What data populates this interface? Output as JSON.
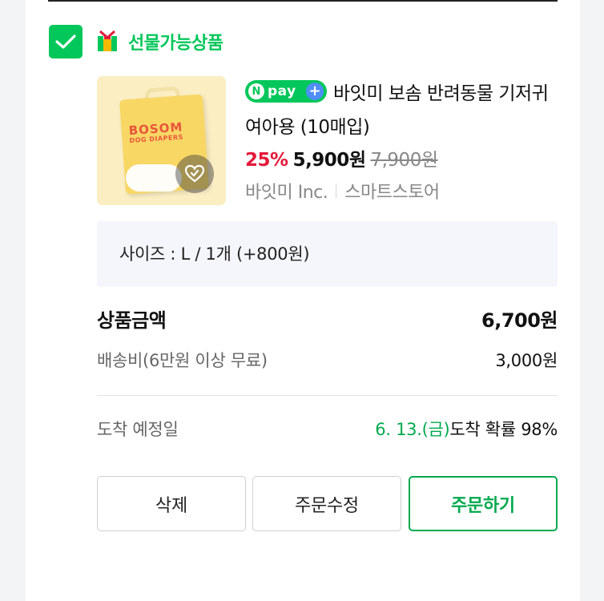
{
  "group": {
    "checked": true,
    "title": "선물가능상품",
    "icon": "gift-icon"
  },
  "product": {
    "thumbnail_text": "BOSOM",
    "thumbnail_subtext": "DOG DIAPERS",
    "wish_icon": "heart-check-icon",
    "badge": {
      "n": "N",
      "text": "pay",
      "plus": "+"
    },
    "name": "바잇미 보솜 반려동물 기저귀 여아용 (10매입)",
    "discount": "25%",
    "price": "5,900원",
    "original_price": "7,900원",
    "seller": "바잇미 Inc.",
    "store_type": "스마트스토어"
  },
  "option": {
    "text": "사이즈 : L / 1개 (+800원)"
  },
  "summary": {
    "total_label": "상품금액",
    "total_value": "6,700원",
    "shipping_label": "배송비(6만원 이상 무료)",
    "shipping_value": "3,000원",
    "eta_label": "도착 예정일",
    "eta_date": "6. 13.(금)",
    "eta_suffix": "도착 확률 98%"
  },
  "buttons": {
    "delete": "삭제",
    "modify": "주문수정",
    "order": "주문하기"
  },
  "colors": {
    "accent": "#03c75a",
    "discount": "#e3193a",
    "npay_plus": "#4f8ef7",
    "option_bg": "#f4f6fb"
  }
}
